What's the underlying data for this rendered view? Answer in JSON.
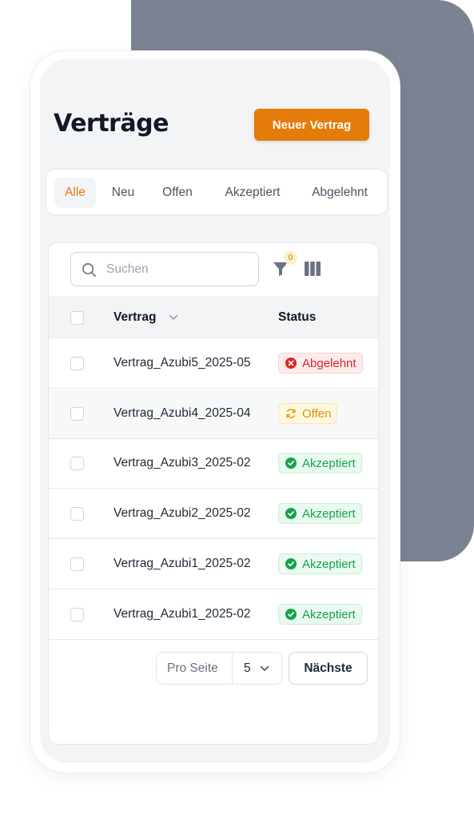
{
  "header": {
    "title": "Verträge",
    "new_button_label": "Neuer Vertrag"
  },
  "tabs": [
    {
      "label": "Alle",
      "active": true
    },
    {
      "label": "Neu",
      "active": false
    },
    {
      "label": "Offen",
      "active": false
    },
    {
      "label": "Akzeptiert",
      "active": false
    },
    {
      "label": "Abgelehnt",
      "active": false
    }
  ],
  "toolbar": {
    "search_placeholder": "Suchen",
    "filter_count": "0",
    "filter_icon": "filter-icon",
    "columns_icon": "columns-icon"
  },
  "table": {
    "columns": {
      "contract": "Vertrag",
      "status": "Status"
    },
    "rows": [
      {
        "name": "Vertrag_Azubi5_2025-05",
        "status": "Abgelehnt",
        "status_type": "rejected"
      },
      {
        "name": "Vertrag_Azubi4_2025-04",
        "status": "Offen",
        "status_type": "open"
      },
      {
        "name": "Vertrag_Azubi3_2025-02",
        "status": "Akzeptiert",
        "status_type": "accepted"
      },
      {
        "name": "Vertrag_Azubi2_2025-02",
        "status": "Akzeptiert",
        "status_type": "accepted"
      },
      {
        "name": "Vertrag_Azubi1_2025-02",
        "status": "Akzeptiert",
        "status_type": "accepted"
      },
      {
        "name": "Vertrag_Azubi1_2025-02",
        "status": "Akzeptiert",
        "status_type": "accepted"
      }
    ]
  },
  "pagination": {
    "per_page_label": "Pro Seite",
    "per_page_value": "5",
    "next_label": "Nächste"
  },
  "colors": {
    "accent": "#e47c0c",
    "rejected": "#dc2626",
    "open": "#d99500",
    "accepted": "#16a34a",
    "backdrop": "#7b8392"
  }
}
